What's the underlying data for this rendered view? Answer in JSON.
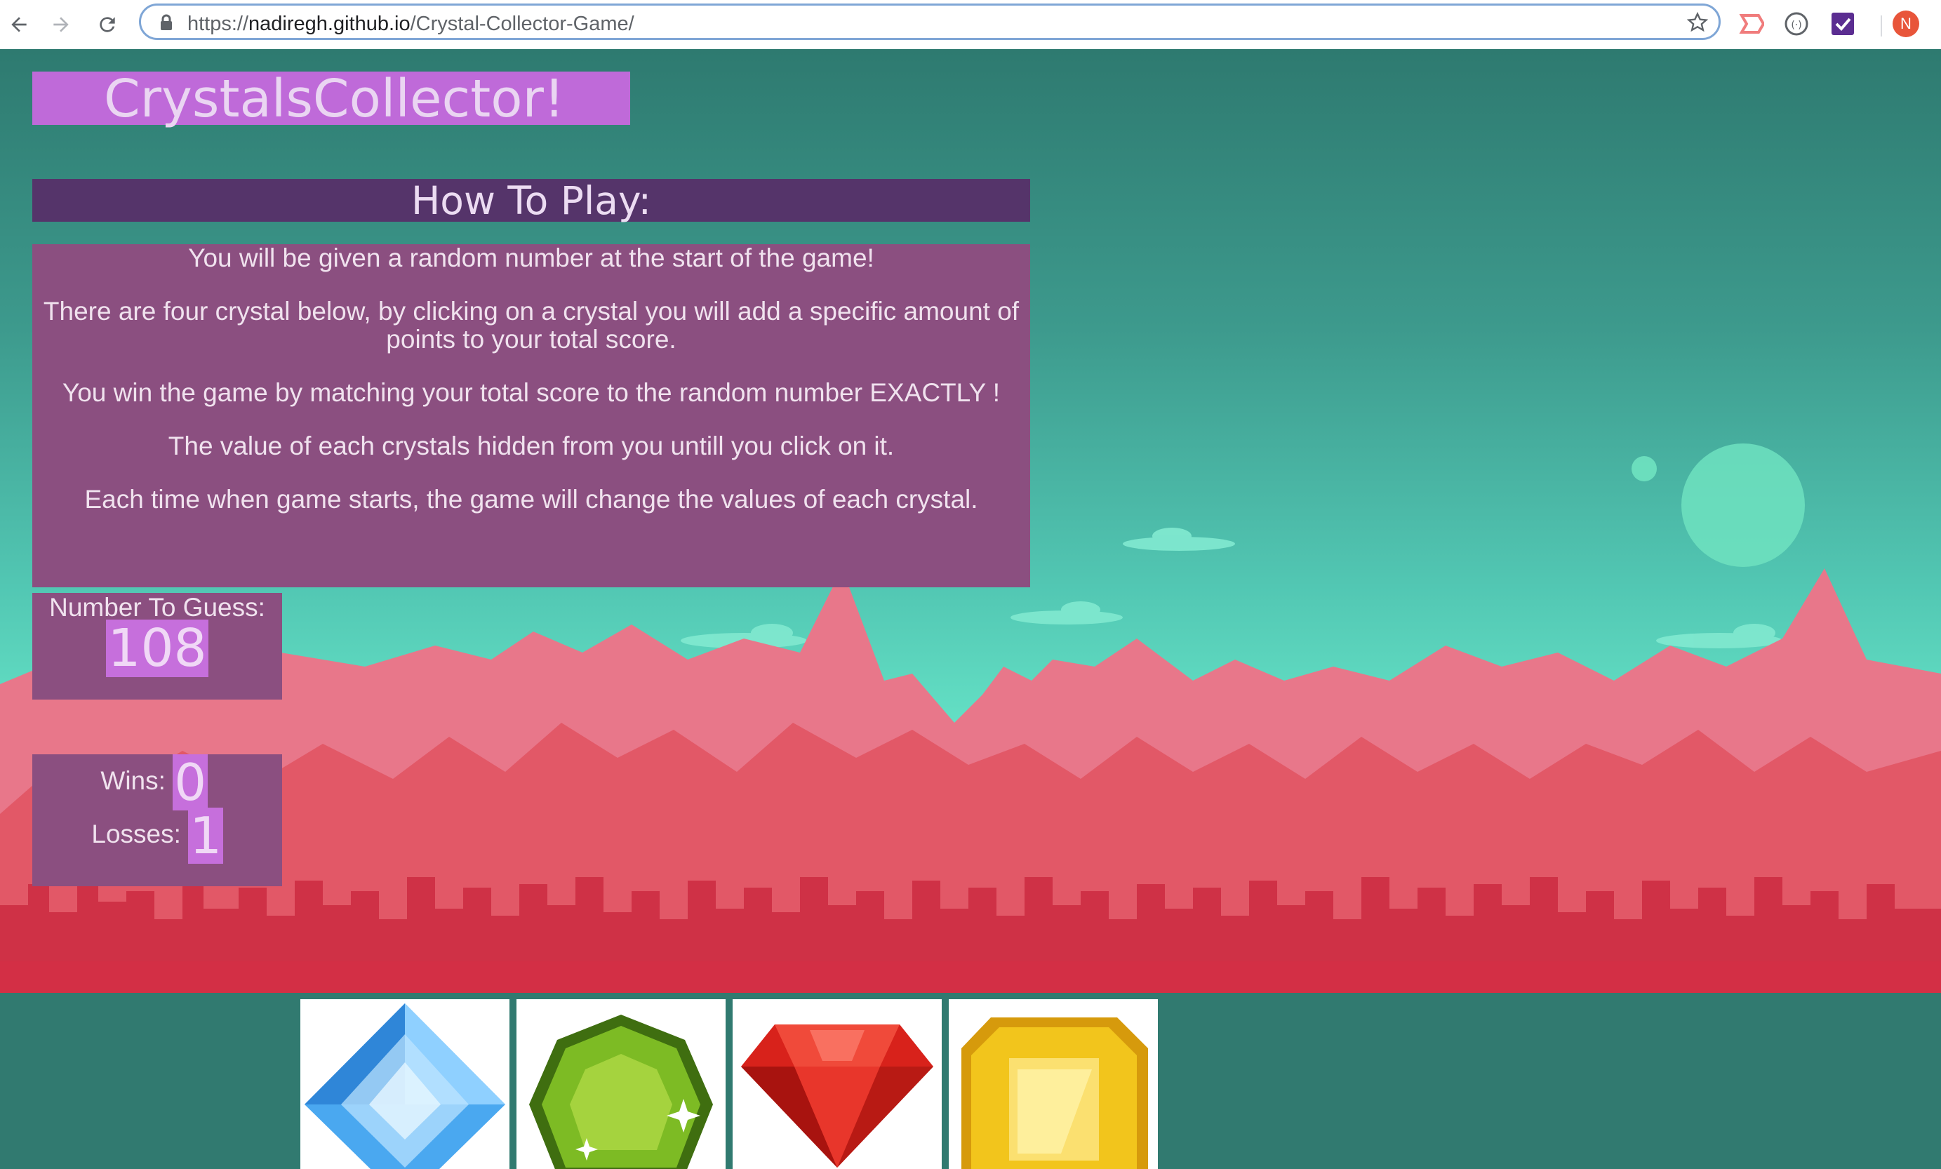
{
  "browser": {
    "url_scheme": "https://",
    "url_host": "nadiregh.github.io",
    "url_path": "/Crystal-Collector-Game/",
    "profile_initial": "N"
  },
  "game": {
    "title": "CrystalsCollector!",
    "how_to_play_heading": "How To Play:",
    "rules": [
      "You will be given a random number at the start of the game!",
      "There are four crystal below, by clicking on a crystal you will add a specific amount of points to your total score.",
      "You win the game by matching your total score to the random number EXACTLY !",
      "The value of each crystals hidden from you untill you click on it.",
      "Each time when game starts, the game will change the values of each crystal."
    ],
    "number_to_guess_label": "Number To Guess:",
    "number_to_guess": "108",
    "wins_label": "Wins:",
    "wins": "0",
    "losses_label": "Losses:",
    "losses": "1"
  },
  "crystals": [
    {
      "name": "blue-crystal",
      "color": "#4aa8f0"
    },
    {
      "name": "green-crystal",
      "color": "#6aa51f"
    },
    {
      "name": "red-crystal",
      "color": "#d8221b"
    },
    {
      "name": "yellow-crystal",
      "color": "#f2c51c"
    }
  ],
  "colors": {
    "title_bg": "#bf6ad9",
    "heading_bg": "#55346a",
    "panel_bg": "#8b4f80",
    "value_highlight": "#c66fdc"
  }
}
